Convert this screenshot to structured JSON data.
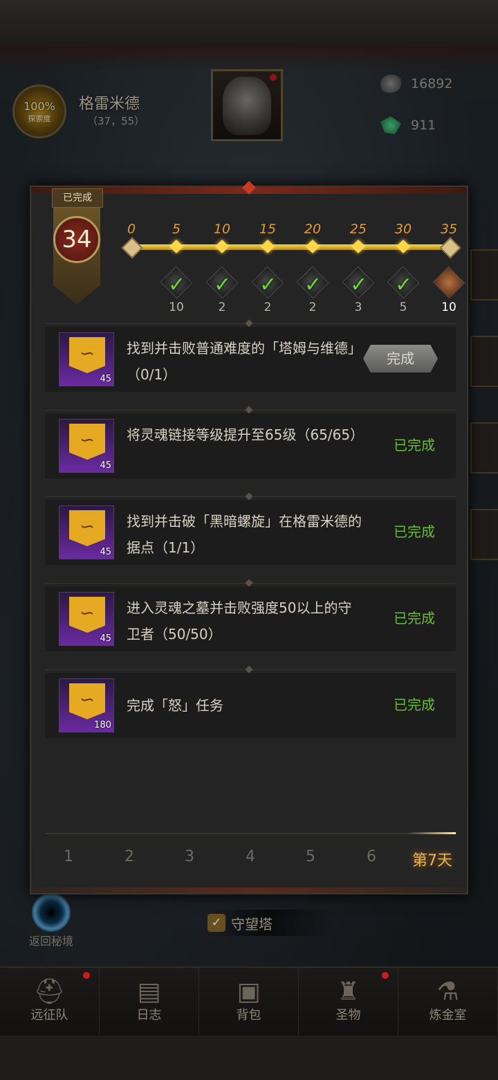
{
  "header": {
    "explore_pct": "100%",
    "explore_label": "探索度",
    "map_name": "格雷米德",
    "map_coords": "（37，55）",
    "resources": [
      {
        "icon": "stone-currency-icon",
        "value": "16892"
      },
      {
        "icon": "green-gem-icon",
        "value": "911"
      }
    ]
  },
  "panel": {
    "badge_label": "已完成",
    "badge_value": "34",
    "milestones": [
      "0",
      "5",
      "10",
      "15",
      "20",
      "25",
      "30",
      "35"
    ],
    "rewards": [
      {
        "qty": "10",
        "claimed": true
      },
      {
        "qty": "2",
        "claimed": true
      },
      {
        "qty": "2",
        "claimed": true
      },
      {
        "qty": "2",
        "claimed": true
      },
      {
        "qty": "3",
        "claimed": true
      },
      {
        "qty": "5",
        "claimed": true
      },
      {
        "qty": "10",
        "claimed": false,
        "icon": "scroll-icon"
      }
    ],
    "tasks": [
      {
        "text": "找到并击败普通难度的「塔姆与维德」（0/1）",
        "qty": "45",
        "status": "完成",
        "status_type": "button"
      },
      {
        "text": "将灵魂链接等级提升至65级（65/65）",
        "qty": "45",
        "status": "已完成",
        "status_type": "done"
      },
      {
        "text": "找到并击破「黑暗螺旋」在格雷米德的据点（1/1）",
        "qty": "45",
        "status": "已完成",
        "status_type": "done"
      },
      {
        "text": "进入灵魂之墓并击败强度50以上的守卫者（50/50）",
        "qty": "45",
        "status": "已完成",
        "status_type": "done"
      },
      {
        "text": "完成「怒」任务",
        "qty": "180",
        "status": "已完成",
        "status_type": "done"
      }
    ],
    "days": [
      "1",
      "2",
      "3",
      "4",
      "5",
      "6",
      "第7天"
    ],
    "active_day": "第7天"
  },
  "map_overlay": {
    "return_label": "返回秘境",
    "watchtower_label": "守望塔"
  },
  "nav": {
    "items": [
      {
        "label": "远征队",
        "icon": "helmet-icon",
        "badge": true
      },
      {
        "label": "日志",
        "icon": "journal-icon",
        "badge": false
      },
      {
        "label": "背包",
        "icon": "backpack-icon",
        "badge": false
      },
      {
        "label": "圣物",
        "icon": "relic-icon",
        "badge": true
      },
      {
        "label": "炼金室",
        "icon": "alchemy-icon",
        "badge": false
      }
    ]
  },
  "colors": {
    "accent_gold": "#e59a34",
    "done_green": "#67c034",
    "purple_icon": "#6a2aa0"
  }
}
